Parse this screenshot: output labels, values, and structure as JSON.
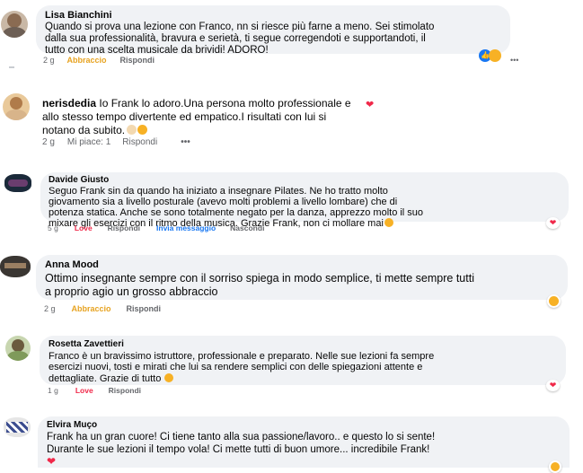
{
  "comments": [
    {
      "name": "Lisa Bianchini",
      "lines": [
        "Quando si prova una lezione con Franco, nn si riesce più farne a meno. Sei stimolato",
        "dalla sua professionalità, bravura e serietà, ti segue corregendoti e supportandoti, il",
        "tutto con una scelta musicale da brividi! ADORO!"
      ],
      "time": "2 g",
      "reaction": "Abbraccio",
      "reply": "Rispondi"
    },
    {
      "name": "nerisdedia",
      "lines": [
        "Io Frank lo adoro.Una persona molto professionale e",
        "allo stesso tempo divertente ed empatico.I risultati con lui si",
        "notano da subito."
      ],
      "time": "2 g",
      "reaction": "Mi piace: 1",
      "reply": "Rispondi",
      "more": "•••"
    },
    {
      "name": "Davide Giusto",
      "lines": [
        "Seguo Frank sin da quando ha iniziato a insegnare Pilates. Ne ho tratto molto",
        "giovamento sia a livello posturale (avevo molti problemi a livello lombare) che di",
        "potenza statica. Anche se sono totalmente negato per la danza, apprezzo molto il suo",
        "mixare gli esercizi con il ritmo della musica. Grazie Frank, non ci mollare mai"
      ],
      "time": "5 g",
      "reaction": "Love",
      "reply": "Rispondi",
      "message": "Invia messaggio",
      "hide": "Nascondi"
    },
    {
      "name": "Anna Mood",
      "lines": [
        "Ottimo insegnante sempre con il sorriso spiega in modo semplice, ti mette sempre tutti",
        "a proprio agio un grosso abbraccio"
      ],
      "time": "2 g",
      "reaction": "Abbraccio",
      "reply": "Rispondi"
    },
    {
      "name": "Rosetta Zavettieri",
      "lines": [
        "Franco è un bravissimo istruttore, professionale e preparato. Nelle sue lezioni fa sempre",
        "esercizi nuovi, tosti e mirati che lui sa rendere semplici con delle spiegazioni attente e",
        "dettagliate. Grazie di tutto"
      ],
      "time": "1 g",
      "reaction": "Love",
      "reply": "Rispondi"
    },
    {
      "name": "Elvira Muço",
      "lines": [
        "Frank ha un gran cuore! Ci tiene tanto alla sua passione/lavoro.. e questo lo si sente!",
        "Durante le sue lezioni il tempo vola! Ci mette tutti di buon umore... incredibile Frank!"
      ]
    }
  ],
  "colors": {
    "bubble": "#f0f2f5",
    "meta": "#65676b",
    "abbraccio": "#e7a321",
    "love": "#f02849",
    "link": "#1877f2"
  }
}
